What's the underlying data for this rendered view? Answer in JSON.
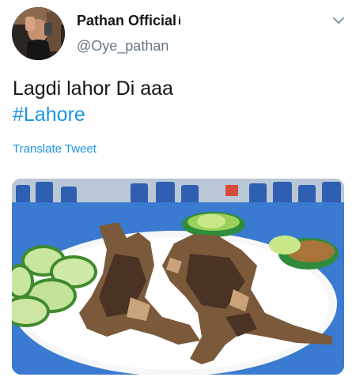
{
  "tweet": {
    "author": {
      "display_name": "Pathan Official",
      "verified_mark": "i",
      "handle": "@Oye_pathan",
      "avatar_icon": "profile-photo"
    },
    "menu_icon": "chevron-down-icon",
    "text": {
      "line1": "Lagdi lahor Di aaa",
      "hashtag": "#Lahore"
    },
    "translate_label": "Translate Tweet",
    "media": {
      "kind": "photo",
      "icon": "photo-image"
    }
  },
  "colors": {
    "link": "#1b95e0",
    "secondary_text": "#657786",
    "primary_text": "#14171a"
  }
}
